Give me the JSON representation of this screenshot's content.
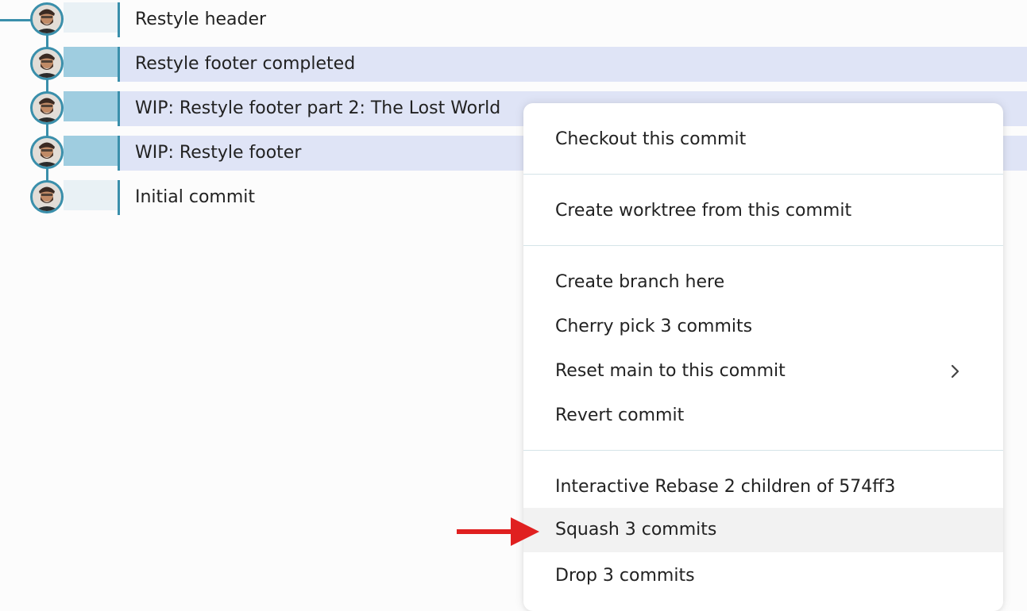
{
  "commits": [
    {
      "message": "Restyle header",
      "selected": false
    },
    {
      "message": "Restyle footer completed",
      "selected": true
    },
    {
      "message": "WIP: Restyle footer part 2: The Lost World",
      "selected": true
    },
    {
      "message": "WIP: Restyle footer",
      "selected": true
    },
    {
      "message": "Initial commit",
      "selected": false
    }
  ],
  "context_menu": {
    "checkout": "Checkout this commit",
    "create_worktree": "Create worktree from this commit",
    "create_branch": "Create branch here",
    "cherry_pick": "Cherry pick 3 commits",
    "reset": "Reset main to this commit",
    "revert": "Revert commit",
    "interactive_rebase": "Interactive Rebase 2 children of 574ff3",
    "squash": "Squash 3 commits",
    "drop": "Drop 3 commits"
  },
  "icons": {
    "submenu": "chevron-right-icon",
    "pointer": "red-arrow-annotation"
  },
  "colors": {
    "branch": "#3a8fab",
    "selected_row": "#dfe4f6",
    "hover_item": "#f2f2f2",
    "annotation_arrow": "#e02020"
  }
}
